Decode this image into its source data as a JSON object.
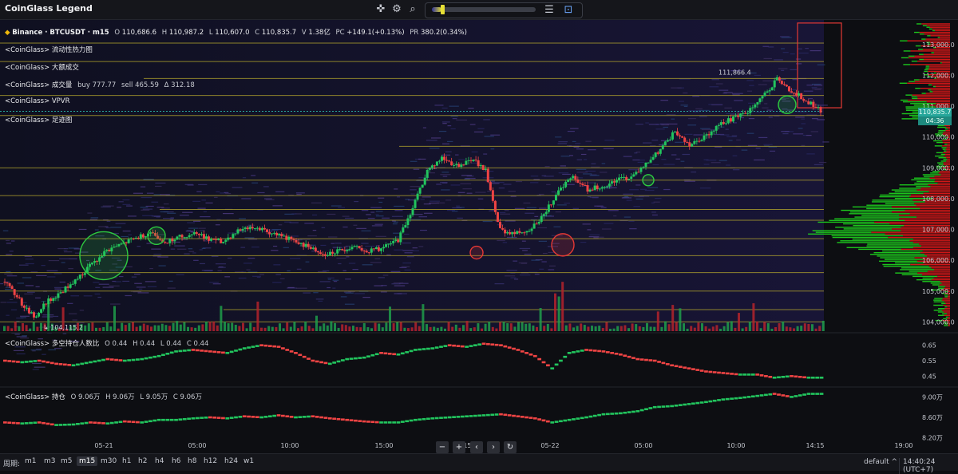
{
  "app": {
    "title": "CoinGlass Legend"
  },
  "toolbar": {
    "icons": [
      "crosshair-icon",
      "settings-icon",
      "search-icon",
      "list-settings-icon",
      "screenshot-icon"
    ],
    "heatmap_range": 0.05
  },
  "header": {
    "symbol": "Binance · BTCUSDT · m15",
    "o_label": "O",
    "o": "110,686.6",
    "h_label": "H",
    "h": "110,987.2",
    "l_label": "L",
    "l": "110,607.0",
    "c_label": "C",
    "c": "110,835.7",
    "v_label": "V",
    "v": "1.38亿",
    "pc_label": "PC",
    "pc": "+149.1(+0.13%)",
    "pr_label": "PR",
    "pr": "380.2(0.34%)"
  },
  "legends": {
    "liquidity": "<CoinGlass> 流动性热力图",
    "large_trades": "<CoinGlass> 大额成交",
    "volume_label": "<CoinGlass> 成交量",
    "volume_buy": "buy 777.77",
    "volume_sell": "sell 465.59",
    "volume_delta": "Δ 312.18",
    "vpvr": "<CoinGlass> VPVR",
    "footprint": "<CoinGlass> 足迹图",
    "ls_label": "<CoinGlass> 多空持仓人数比",
    "ls_o": "O 0.44",
    "ls_h": "H 0.44",
    "ls_l": "L 0.44",
    "ls_c": "C 0.44",
    "oi_label": "<CoinGlass> 持仓",
    "oi_o": "O 9.06万",
    "oi_h": "H 9.06万",
    "oi_l": "L 9.05万",
    "oi_c": "C 9.06万"
  },
  "annotations": {
    "high": "111,866.4",
    "low": "104,115.2"
  },
  "price_badge": {
    "price": "110,835.7",
    "countdown": "04:36"
  },
  "nav": {
    "zoom_out": "−",
    "zoom_in": "+",
    "left": "‹",
    "right": "›",
    "reset": "↻"
  },
  "bottom": {
    "period_label": "周期:",
    "periods": [
      "m1",
      "m3",
      "m5",
      "m15",
      "m30",
      "h1",
      "h2",
      "h4",
      "h6",
      "h8",
      "h12",
      "h24",
      "w1"
    ],
    "active_period": "m15",
    "theme": "default",
    "caret": "^",
    "time": "14:40:24 (UTC+7)"
  },
  "colors": {
    "up": "#22c55e",
    "down": "#ef4444",
    "vpvr_up": "#1ed81e",
    "vpvr_down": "#e81818",
    "accent": "#26a69a",
    "heat_line": "#b7a92c"
  },
  "chart_data": [
    {
      "type": "candlestick",
      "title": "Binance · BTCUSDT · m15",
      "y_ticks": [
        "113,000.0",
        "112,000.0",
        "111,000.0",
        "110,000.0",
        "109,000.0",
        "108,000.0",
        "107,000.0",
        "106,000.0",
        "105,000.0",
        "104,000.0"
      ],
      "ylim": [
        103700,
        113800
      ],
      "x_ticks": [
        "05-21",
        "05:00",
        "10:00",
        "15:00",
        "19:15",
        "05-22",
        "05:00",
        "10:00",
        "14:15",
        "19:00"
      ],
      "close_path": [
        105300,
        104700,
        104150,
        104700,
        105000,
        105400,
        105900,
        106300,
        106500,
        106700,
        106900,
        106600,
        106750,
        106900,
        106700,
        106600,
        106950,
        107100,
        106950,
        106800,
        106600,
        106400,
        106200,
        106300,
        106450,
        106300,
        106400,
        106650,
        107700,
        108900,
        109300,
        109050,
        109300,
        108900,
        107000,
        106850,
        107000,
        107450,
        108300,
        108700,
        108300,
        108400,
        108600,
        108700,
        109150,
        109600,
        110200,
        109750,
        110000,
        110400,
        110600,
        110800,
        111300,
        111866,
        111500,
        111200,
        110835
      ],
      "current_price": 110835.7,
      "annotated_high": 111866.4,
      "annotated_low": 104115.2
    },
    {
      "type": "line",
      "title": "<CoinGlass> 多空持仓人数比",
      "y_ticks": [
        "0.65",
        "0.55",
        "0.45"
      ],
      "ylim": [
        0.4,
        0.7
      ],
      "values": [
        0.55,
        0.54,
        0.55,
        0.53,
        0.52,
        0.54,
        0.56,
        0.55,
        0.56,
        0.58,
        0.61,
        0.62,
        0.61,
        0.6,
        0.63,
        0.65,
        0.64,
        0.6,
        0.55,
        0.53,
        0.56,
        0.57,
        0.6,
        0.59,
        0.62,
        0.63,
        0.65,
        0.64,
        0.66,
        0.65,
        0.62,
        0.58,
        0.5,
        0.6,
        0.62,
        0.61,
        0.59,
        0.56,
        0.55,
        0.52,
        0.5,
        0.48,
        0.47,
        0.46,
        0.46,
        0.44,
        0.45,
        0.44
      ],
      "last": 0.44
    },
    {
      "type": "line",
      "title": "<CoinGlass> 持仓",
      "y_ticks": [
        "9.00万",
        "8.60万",
        "8.20万"
      ],
      "ylim": [
        8.1,
        9.1
      ],
      "values": [
        8.5,
        8.48,
        8.5,
        8.45,
        8.46,
        8.5,
        8.48,
        8.52,
        8.5,
        8.55,
        8.55,
        8.58,
        8.6,
        8.58,
        8.62,
        8.6,
        8.64,
        8.6,
        8.62,
        8.58,
        8.55,
        8.52,
        8.5,
        8.5,
        8.55,
        8.58,
        8.6,
        8.62,
        8.64,
        8.66,
        8.62,
        8.58,
        8.5,
        8.55,
        8.6,
        8.66,
        8.68,
        8.72,
        8.8,
        8.82,
        8.86,
        8.9,
        8.95,
        8.98,
        9.02,
        9.06,
        9.0,
        9.06
      ],
      "last": "9.06万"
    }
  ]
}
